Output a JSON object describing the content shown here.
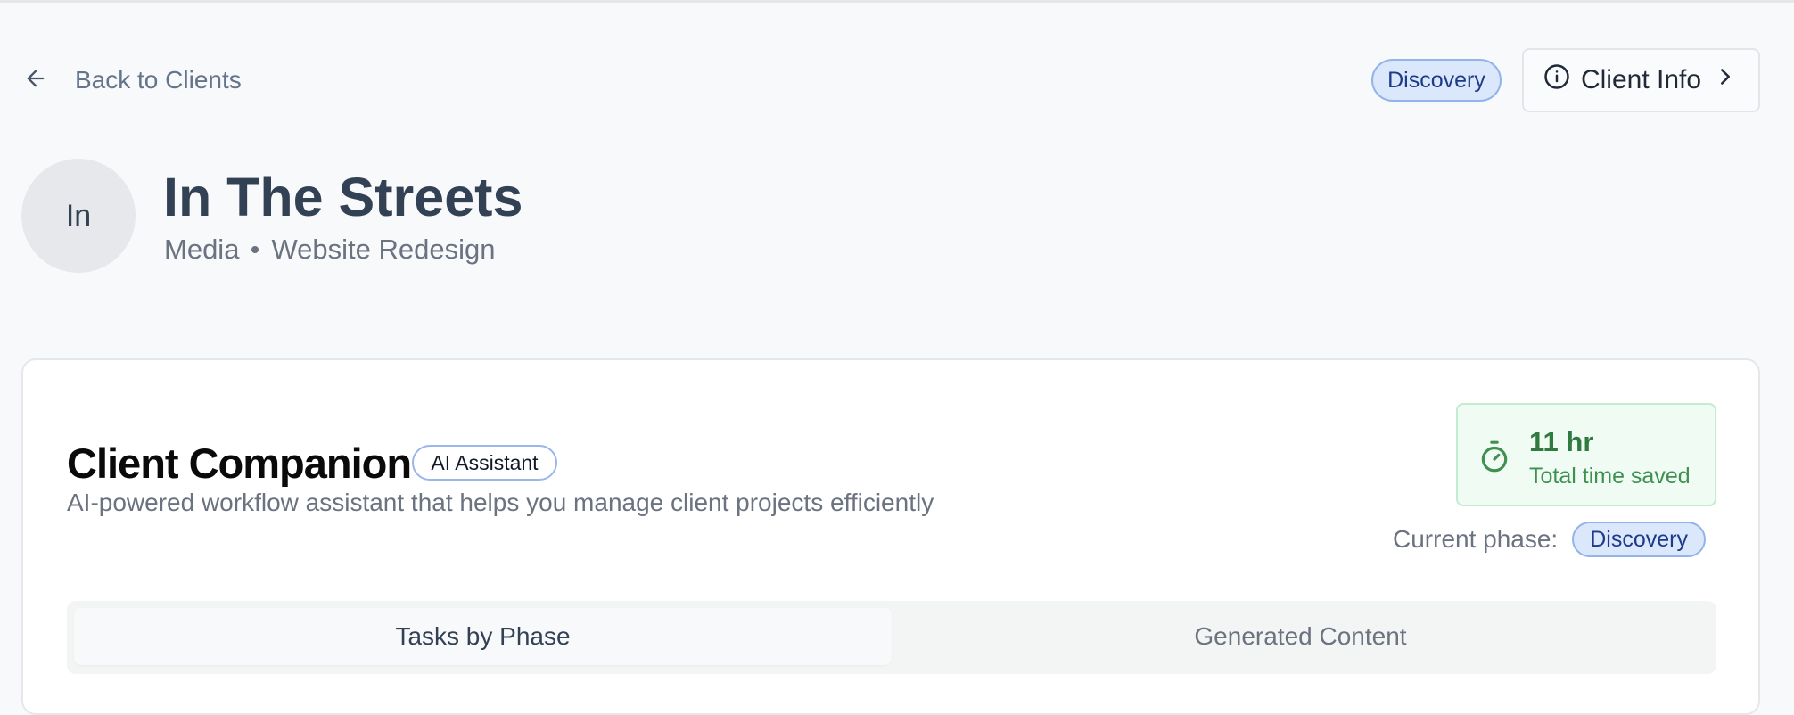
{
  "nav": {
    "back_label": "Back to Clients",
    "phase_badge": "Discovery",
    "client_info_label": "Client Info"
  },
  "client": {
    "initials": "In",
    "name": "In The Streets",
    "industry": "Media",
    "project": "Website Redesign"
  },
  "companion": {
    "title": "Client Companion",
    "badge": "AI Assistant",
    "description": "AI-powered workflow assistant that helps you manage client projects efficiently",
    "time_saved": {
      "value": "11 hr",
      "label": "Total time saved"
    },
    "current_phase_label": "Current phase:",
    "current_phase": "Discovery"
  },
  "tabs": [
    {
      "label": "Tasks by Phase",
      "active": true
    },
    {
      "label": "Generated Content",
      "active": false
    }
  ],
  "colors": {
    "background": "#f8f9fb",
    "phase_badge_bg": "#dbe7fb",
    "phase_badge_text": "#1e3a8a",
    "time_saved_bg": "#f0fbf3",
    "time_saved_text": "#2f7a3e"
  },
  "icons": {
    "back": "arrow-left-icon",
    "info": "info-circle-icon",
    "chevron": "chevron-right-icon",
    "timer": "stopwatch-icon"
  }
}
